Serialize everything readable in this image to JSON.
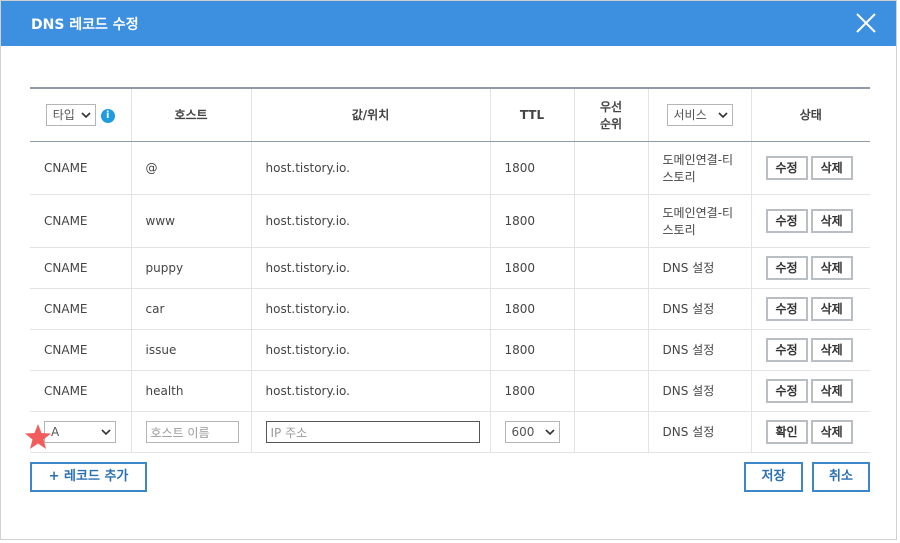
{
  "dialog": {
    "title": "DNS 레코드 수정"
  },
  "table": {
    "headers": {
      "type_select": "타입",
      "host": "호스트",
      "value": "값/위치",
      "ttl": "TTL",
      "priority_line1": "우선",
      "priority_line2": "순위",
      "service_select": "서비스",
      "status": "상태"
    },
    "rows": [
      {
        "type": "CNAME",
        "host": "@",
        "value": "host.tistory.io.",
        "ttl": "1800",
        "service_line1": "도메인연결-티",
        "service_line2": "스토리",
        "edit": "수정",
        "delete": "삭제"
      },
      {
        "type": "CNAME",
        "host": "www",
        "value": "host.tistory.io.",
        "ttl": "1800",
        "service_line1": "도메인연결-티",
        "service_line2": "스토리",
        "edit": "수정",
        "delete": "삭제"
      },
      {
        "type": "CNAME",
        "host": "puppy",
        "value": "host.tistory.io.",
        "ttl": "1800",
        "service": "DNS 설정",
        "edit": "수정",
        "delete": "삭제"
      },
      {
        "type": "CNAME",
        "host": "car",
        "value": "host.tistory.io.",
        "ttl": "1800",
        "service": "DNS 설정",
        "edit": "수정",
        "delete": "삭제"
      },
      {
        "type": "CNAME",
        "host": "issue",
        "value": "host.tistory.io.",
        "ttl": "1800",
        "service": "DNS 설정",
        "edit": "수정",
        "delete": "삭제"
      },
      {
        "type": "CNAME",
        "host": "health",
        "value": "host.tistory.io.",
        "ttl": "1800",
        "service": "DNS 설정",
        "edit": "수정",
        "delete": "삭제"
      }
    ],
    "new_row": {
      "type_value": "A",
      "host_placeholder": "호스트 이름",
      "value_placeholder": "IP 주소",
      "ttl_value": "600",
      "service": "DNS 설정",
      "confirm": "확인",
      "delete": "삭제"
    }
  },
  "footer": {
    "add_record": "+ 레코드 추가",
    "save": "저장",
    "cancel": "취소"
  },
  "icons": {
    "close": "close-icon",
    "info": "info-icon",
    "star": "star-marker-icon"
  },
  "colors": {
    "header_bg": "#3d8fdf",
    "button_border": "#3d86c9",
    "star": "#f25c5c"
  }
}
